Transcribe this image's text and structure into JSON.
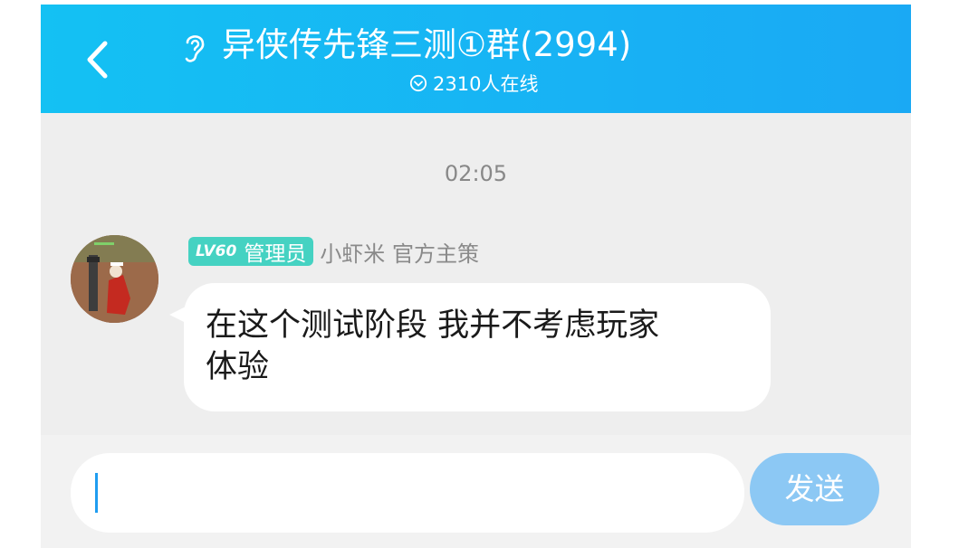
{
  "header": {
    "title": "异侠传先锋三测①群(2994)",
    "online_count": "2310人在线",
    "background_color": "#1ab4f3",
    "back_icon": "chevron-left-icon",
    "listen_icon": "ear-icon"
  },
  "chat": {
    "timestamp": "02:05",
    "messages": [
      {
        "level_badge": "LV60",
        "role_badge": "管理员",
        "badge_color": "#45d2c2",
        "sender": "小虾米 官方主策",
        "text_line_1": "在这个测试阶段 我并不考虑玩家",
        "text_line_2": "体验"
      }
    ]
  },
  "composer": {
    "input_value": "",
    "send_label": "发送",
    "send_color": "#8cc8f4"
  }
}
